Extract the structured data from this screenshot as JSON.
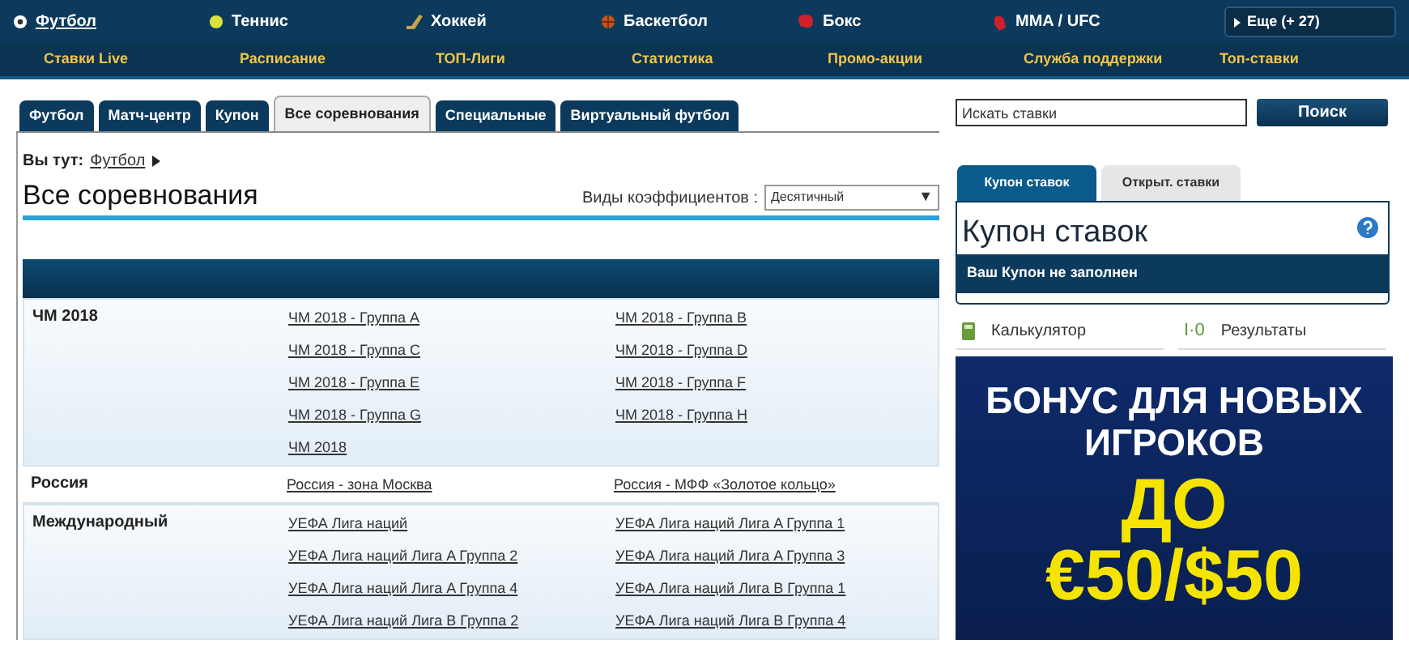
{
  "sports_nav": [
    {
      "label": "Футбол",
      "selected": true,
      "kind": "football"
    },
    {
      "label": "Теннис",
      "selected": false,
      "kind": "tennis"
    },
    {
      "label": "Хоккей",
      "selected": false,
      "kind": "hockey"
    },
    {
      "label": "Баскетбол",
      "selected": false,
      "kind": "basketball"
    },
    {
      "label": "Бокс",
      "selected": false,
      "kind": "boxing"
    },
    {
      "label": "MMA / UFC",
      "selected": false,
      "kind": "mma"
    }
  ],
  "more_button": "Еще (+ 27)",
  "sub_nav": [
    "Ставки Live",
    "Расписание",
    "ТОП-Лиги",
    "Статистика",
    "Промо-акции",
    "Служба поддержки",
    "Топ-ставки"
  ],
  "tabs": [
    {
      "label": "Футбол",
      "selected": false
    },
    {
      "label": "Матч-центр",
      "selected": false
    },
    {
      "label": "Купон",
      "selected": false
    },
    {
      "label": "Все соревнования",
      "selected": true
    },
    {
      "label": "Специальные",
      "selected": false
    },
    {
      "label": "Виртуальный футбол",
      "selected": false
    }
  ],
  "breadcrumb": {
    "label": "Вы тут:",
    "link": "Футбол"
  },
  "page_title": "Все соревнования",
  "odds_format": {
    "label": "Виды коэффициентов :",
    "value": "Десятичный",
    "arrow": "▼"
  },
  "competitions": [
    {
      "region": "ЧМ 2018",
      "shaded": true,
      "links": [
        "ЧМ 2018 - Группа A",
        "ЧМ 2018 - Группа B",
        "ЧМ 2018 - Группа C",
        "ЧМ 2018 - Группа D",
        "ЧМ 2018 - Группа E",
        "ЧМ 2018 - Группа F",
        "ЧМ 2018 - Группа G",
        "ЧМ 2018 - Группа H",
        "ЧМ 2018"
      ]
    },
    {
      "region": "Россия",
      "shaded": false,
      "links": [
        "Россия - зона Москва",
        "Россия - МФФ «Золотое кольцо»"
      ]
    },
    {
      "region": "Международный",
      "shaded": true,
      "links": [
        "УЕФА Лига наций",
        "УЕФА Лига наций Лига A Группа 1",
        "УЕФА Лига наций Лига A Группа 2",
        "УЕФА Лига наций Лига A Группа 3",
        "УЕФА Лига наций Лига A Группа 4",
        "УЕФА Лига наций Лига B Группа 1",
        "УЕФА Лига наций Лига B Группа 2",
        "УЕФА Лига наций Лига B Группа 4"
      ]
    }
  ],
  "search": {
    "placeholder": "Искать ставки",
    "button": "Поиск"
  },
  "slip_tabs": [
    {
      "label": "Купон ставок",
      "selected": true
    },
    {
      "label": "Открыт. ставки",
      "selected": false
    }
  ],
  "slip": {
    "title": "Купон ставок",
    "empty_message": "Ваш Купон не заполнен"
  },
  "tools": [
    {
      "label": "Калькулятор",
      "kind": "calculator"
    },
    {
      "label": "Результаты",
      "kind": "results",
      "icon_text": "I·0"
    }
  ],
  "banner": {
    "headline": "БОНУС ДЛЯ НОВЫХ ИГРОКОВ",
    "line_2": "ДО",
    "amount": "€50/$50"
  }
}
